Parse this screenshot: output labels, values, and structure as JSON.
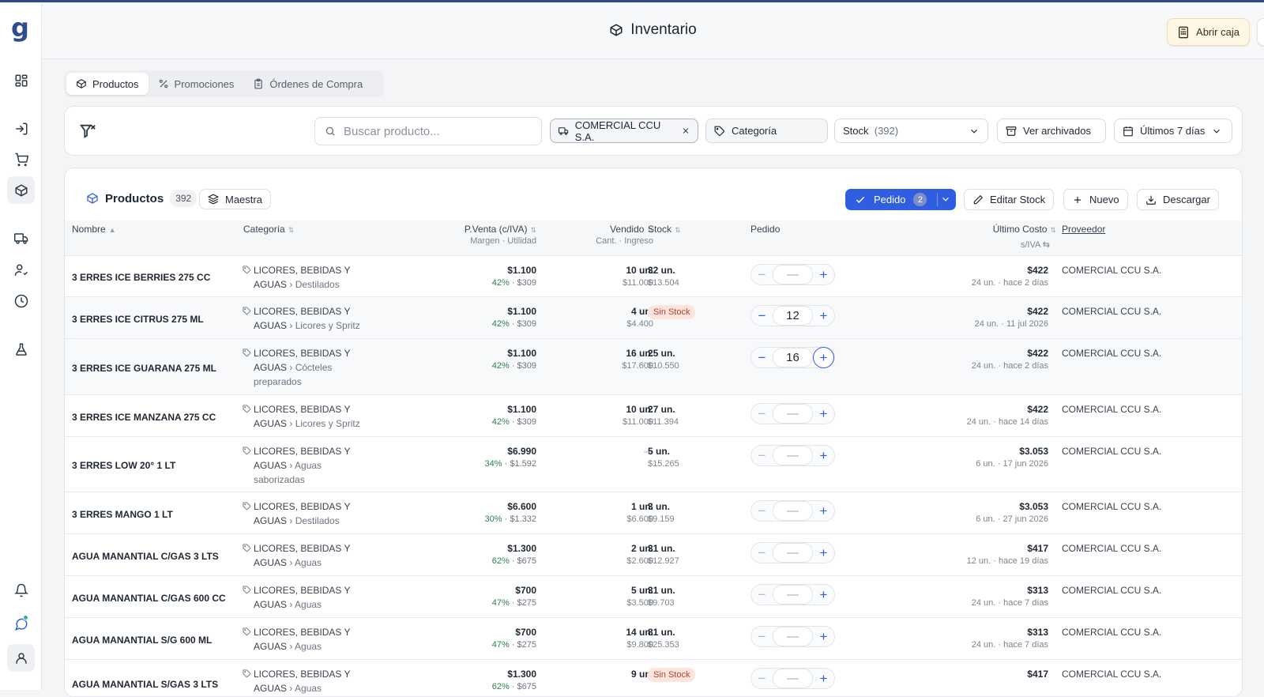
{
  "app": {
    "logo": "g"
  },
  "header": {
    "title": "Inventario",
    "abrir_caja": "Abrir caja"
  },
  "tabs": [
    {
      "label": "Productos",
      "active": true
    },
    {
      "label": "Promociones",
      "active": false
    },
    {
      "label": "Órdenes de Compra",
      "active": false
    }
  ],
  "filters": {
    "search_placeholder": "Buscar producto...",
    "proveedor": "COMERCIAL CCU S.A.",
    "categoria": "Categoría",
    "stock_label": "Stock",
    "stock_count": "(392)",
    "archivados": "Ver archivados",
    "fecha": "Últimos 7 días"
  },
  "panel": {
    "title": "Productos",
    "count": "392",
    "maestra": "Maestra",
    "pedido": "Pedido",
    "pedido_count": "2",
    "editar_stock": "Editar Stock",
    "nuevo": "Nuevo",
    "descargar": "Descargar"
  },
  "columns": {
    "nombre": "Nombre",
    "categoria": "Categoría",
    "pventa": "P.Venta (c/IVA)",
    "pventa_sub": "Margen · Utilidad",
    "vendido": "Vendido",
    "vendido_sub": "Cant. · Ingreso",
    "stock": "Stock",
    "pedido": "Pedido",
    "costo": "Último Costo",
    "costo_sub": "s/IVA ⇆",
    "proveedor": "Proveedor"
  },
  "rows": [
    {
      "name": "3 ERRES ICE BERRIES 275 CC",
      "cat1": "LICORES, BEBIDAS Y",
      "cat2": "AGUAS",
      "sub": "Destilados",
      "price": "$1.100",
      "pct": "42%",
      "util": "· $309",
      "vend": "10 un.",
      "vend_sub": "$11.000",
      "stock": "32 un.",
      "stock_sub": "$13.504",
      "pedido": "—",
      "cost": "$422",
      "cost_sub": "24 un. · hace 2 días",
      "prov": "COMERCIAL CCU S.A."
    },
    {
      "name": "3 ERRES ICE CITRUS 275 ML",
      "cat1": "LICORES, BEBIDAS Y",
      "cat2": "AGUAS",
      "sub": "Licores y Spritz",
      "price": "$1.100",
      "pct": "42%",
      "util": "· $309",
      "vend": "4 un.",
      "vend_sub": "$4.400",
      "stock": "Sin Stock",
      "stock_sub": "",
      "pedido": "12",
      "cost": "$422",
      "cost_sub": "24 un. · 11 jul 2026",
      "prov": "COMERCIAL CCU S.A."
    },
    {
      "name": "3 ERRES ICE GUARANA 275 ML",
      "cat1": "LICORES, BEBIDAS Y",
      "cat2": "AGUAS",
      "sub": "Cócteles",
      "sub2": "preparados",
      "price": "$1.100",
      "pct": "42%",
      "util": "· $309",
      "vend": "16 un.",
      "vend_sub": "$17.600",
      "stock": "25 un.",
      "stock_sub": "$10.550",
      "pedido": "16",
      "cost": "$422",
      "cost_sub": "24 un. · hace 2 días",
      "prov": "COMERCIAL CCU S.A."
    },
    {
      "name": "3 ERRES ICE MANZANA 275 CC",
      "cat1": "LICORES, BEBIDAS Y",
      "cat2": "AGUAS",
      "sub": "Licores y Spritz",
      "price": "$1.100",
      "pct": "42%",
      "util": "· $309",
      "vend": "10 un.",
      "vend_sub": "$11.000",
      "stock": "27 un.",
      "stock_sub": "$11.394",
      "pedido": "—",
      "cost": "$422",
      "cost_sub": "24 un. · hace 14 días",
      "prov": "COMERCIAL CCU S.A."
    },
    {
      "name": "3 ERRES LOW 20° 1 LT",
      "cat1": "LICORES, BEBIDAS Y",
      "cat2": "AGUAS",
      "sub": "Aguas",
      "sub2": "saborizadas",
      "price": "$6.990",
      "pct": "34%",
      "util": "· $1.592",
      "vend": "—",
      "vend_sub": "",
      "stock": "5 un.",
      "stock_sub": "$15.265",
      "pedido": "—",
      "cost": "$3.053",
      "cost_sub": "6 un. · 17 jun 2026",
      "prov": "COMERCIAL CCU S.A."
    },
    {
      "name": "3 ERRES MANGO 1 LT",
      "cat1": "LICORES, BEBIDAS Y",
      "cat2": "AGUAS",
      "sub": "Destilados",
      "price": "$6.600",
      "pct": "30%",
      "util": "· $1.332",
      "vend": "1 un.",
      "vend_sub": "$6.600",
      "stock": "3 un.",
      "stock_sub": "$9.159",
      "pedido": "—",
      "cost": "$3.053",
      "cost_sub": "6 un. · 27 jun 2026",
      "prov": "COMERCIAL CCU S.A."
    },
    {
      "name": "AGUA MANANTIAL C/GAS 3 LTS",
      "cat1": "LICORES, BEBIDAS Y",
      "cat2": "AGUAS",
      "sub": "Aguas",
      "price": "$1.300",
      "pct": "62%",
      "util": "· $675",
      "vend": "2 un.",
      "vend_sub": "$2.600",
      "stock": "31 un.",
      "stock_sub": "$12.927",
      "pedido": "—",
      "cost": "$417",
      "cost_sub": "12 un. · hace 19 días",
      "prov": "COMERCIAL CCU S.A."
    },
    {
      "name": "AGUA MANANTIAL C/GAS 600 CC",
      "cat1": "LICORES, BEBIDAS Y",
      "cat2": "AGUAS",
      "sub": "Aguas",
      "price": "$700",
      "pct": "47%",
      "util": "· $275",
      "vend": "5 un.",
      "vend_sub": "$3.500",
      "stock": "31 un.",
      "stock_sub": "$9.703",
      "pedido": "—",
      "cost": "$313",
      "cost_sub": "24 un. · hace 7 días",
      "prov": "COMERCIAL CCU S.A."
    },
    {
      "name": "AGUA MANANTIAL S/G 600 ML",
      "cat1": "LICORES, BEBIDAS Y",
      "cat2": "AGUAS",
      "sub": "Aguas",
      "price": "$700",
      "pct": "47%",
      "util": "· $275",
      "vend": "14 un.",
      "vend_sub": "$9.800",
      "stock": "81 un.",
      "stock_sub": "$25.353",
      "pedido": "—",
      "cost": "$313",
      "cost_sub": "24 un. · hace 7 días",
      "prov": "COMERCIAL CCU S.A."
    },
    {
      "name": "AGUA MANANTIAL S/GAS 3 LTS",
      "cat1": "LICORES, BEBIDAS Y",
      "cat2": "AGUAS",
      "sub": "Aguas",
      "price": "$1.300",
      "pct": "62%",
      "util": "· $675",
      "vend": "9 un.",
      "vend_sub": "",
      "stock": "Sin Stock",
      "stock_sub": "",
      "pedido": "—",
      "cost": "$417",
      "cost_sub": "",
      "prov": "COMERCIAL CCU S.A."
    }
  ],
  "colors": {
    "accent": "#2f5fe0",
    "brand": "#2d4d8e",
    "sin_stock_bg": "#fde4dd",
    "margin_green": "#2f7d4c"
  }
}
